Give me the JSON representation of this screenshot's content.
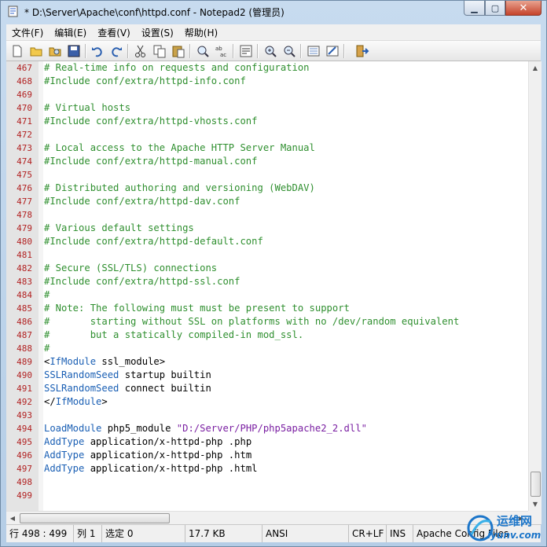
{
  "window": {
    "title": "* D:\\Server\\Apache\\conf\\httpd.conf - Notepad2 (管理员)"
  },
  "menu": [
    "文件(F)",
    "编辑(E)",
    "查看(V)",
    "设置(S)",
    "帮助(H)"
  ],
  "toolbar_icons": [
    "new-file-icon",
    "open-icon",
    "browse-icon",
    "save-icon",
    "undo-icon",
    "redo-icon",
    "cut-icon",
    "copy-icon",
    "paste-icon",
    "find-icon",
    "replace-icon",
    "word-wrap-icon",
    "zoom-in-icon",
    "zoom-out-icon",
    "scheme-icon",
    "customize-icon",
    "exit-icon"
  ],
  "lines": [
    {
      "n": "467",
      "text": "# Real-time info on requests and configuration",
      "type": "comment"
    },
    {
      "n": "468",
      "text": "#Include conf/extra/httpd-info.conf",
      "type": "comment"
    },
    {
      "n": "469",
      "text": "",
      "type": "blank"
    },
    {
      "n": "470",
      "text": "# Virtual hosts",
      "type": "comment"
    },
    {
      "n": "471",
      "text": "#Include conf/extra/httpd-vhosts.conf",
      "type": "comment"
    },
    {
      "n": "472",
      "text": "",
      "type": "blank"
    },
    {
      "n": "473",
      "text": "# Local access to the Apache HTTP Server Manual",
      "type": "comment"
    },
    {
      "n": "474",
      "text": "#Include conf/extra/httpd-manual.conf",
      "type": "comment"
    },
    {
      "n": "475",
      "text": "",
      "type": "blank"
    },
    {
      "n": "476",
      "text": "# Distributed authoring and versioning (WebDAV)",
      "type": "comment"
    },
    {
      "n": "477",
      "text": "#Include conf/extra/httpd-dav.conf",
      "type": "comment"
    },
    {
      "n": "478",
      "text": "",
      "type": "blank"
    },
    {
      "n": "479",
      "text": "# Various default settings",
      "type": "comment"
    },
    {
      "n": "480",
      "text": "#Include conf/extra/httpd-default.conf",
      "type": "comment"
    },
    {
      "n": "481",
      "text": "",
      "type": "blank"
    },
    {
      "n": "482",
      "text": "# Secure (SSL/TLS) connections",
      "type": "comment"
    },
    {
      "n": "483",
      "text": "#Include conf/extra/httpd-ssl.conf",
      "type": "comment"
    },
    {
      "n": "484",
      "text": "#",
      "type": "comment"
    },
    {
      "n": "485",
      "text": "# Note: The following must must be present to support",
      "type": "comment"
    },
    {
      "n": "486",
      "text": "#       starting without SSL on platforms with no /dev/random equivalent",
      "type": "comment"
    },
    {
      "n": "487",
      "text": "#       but a statically compiled-in mod_ssl.",
      "type": "comment"
    },
    {
      "n": "488",
      "text": "#",
      "type": "comment"
    },
    {
      "n": "489",
      "type": "code",
      "parts": [
        {
          "t": "<",
          "c": "tx"
        },
        {
          "t": "IfModule",
          "c": "kw"
        },
        {
          "t": " ssl_module>",
          "c": "tx"
        }
      ]
    },
    {
      "n": "490",
      "type": "code",
      "parts": [
        {
          "t": "SSLRandomSeed",
          "c": "kw"
        },
        {
          "t": " startup builtin",
          "c": "tx"
        }
      ]
    },
    {
      "n": "491",
      "type": "code",
      "parts": [
        {
          "t": "SSLRandomSeed",
          "c": "kw"
        },
        {
          "t": " connect builtin",
          "c": "tx"
        }
      ]
    },
    {
      "n": "492",
      "type": "code",
      "parts": [
        {
          "t": "</",
          "c": "tx"
        },
        {
          "t": "IfModule",
          "c": "kw"
        },
        {
          "t": ">",
          "c": "tx"
        }
      ]
    },
    {
      "n": "493",
      "text": "",
      "type": "blank"
    },
    {
      "n": "494",
      "type": "code",
      "parts": [
        {
          "t": "LoadModule",
          "c": "kw"
        },
        {
          "t": " php5_module ",
          "c": "tx"
        },
        {
          "t": "\"D:/Server/PHP/php5apache2_2.dll\"",
          "c": "st"
        }
      ]
    },
    {
      "n": "495",
      "type": "code",
      "parts": [
        {
          "t": "AddType",
          "c": "kw"
        },
        {
          "t": " application/x-httpd-php .php",
          "c": "tx"
        }
      ]
    },
    {
      "n": "496",
      "type": "code",
      "parts": [
        {
          "t": "AddType",
          "c": "kw"
        },
        {
          "t": " application/x-httpd-php .htm",
          "c": "tx"
        }
      ]
    },
    {
      "n": "497",
      "type": "code",
      "parts": [
        {
          "t": "AddType",
          "c": "kw"
        },
        {
          "t": " application/x-httpd-php .html",
          "c": "tx"
        }
      ]
    },
    {
      "n": "498",
      "text": "",
      "type": "blank"
    },
    {
      "n": "499",
      "text": "",
      "type": "blank"
    }
  ],
  "status": {
    "position": "行 498 : 499",
    "column": "列 1",
    "selection": "选定 0",
    "size": "17.7 KB",
    "encoding": "ANSI",
    "line_ending": "CR+LF",
    "mode": "INS",
    "scheme": "Apache Config Files"
  },
  "watermark": {
    "text": "运维网",
    "url": "iyunv.com"
  }
}
